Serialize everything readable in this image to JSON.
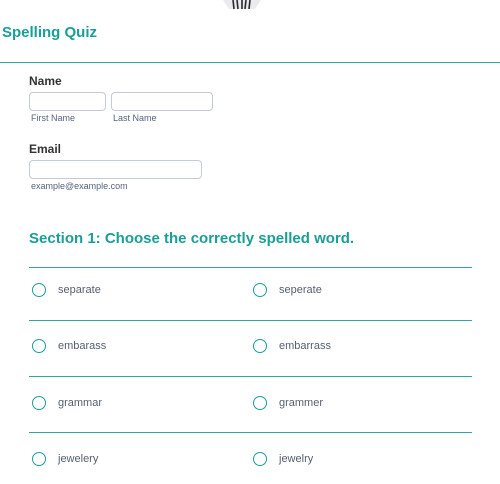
{
  "form": {
    "title": "Spelling Quiz"
  },
  "name_field": {
    "label": "Name",
    "first_name_value": "",
    "last_name_value": "",
    "first_sublabel": "First Name",
    "last_sublabel": "Last Name"
  },
  "email_field": {
    "label": "Email",
    "value": "",
    "sublabel": "example@example.com"
  },
  "section1": {
    "title": "Section 1: Choose the correctly spelled word.",
    "questions": [
      {
        "options": [
          "separate",
          "seperate"
        ]
      },
      {
        "options": [
          "embarass",
          "embarrass"
        ]
      },
      {
        "options": [
          "grammar",
          "grammer"
        ]
      },
      {
        "options": [
          "jewelery",
          "jewelry"
        ]
      }
    ]
  },
  "colors": {
    "accent": "#1a9f97",
    "input_border": "#c3cad8",
    "sublabel_text": "#57647e"
  }
}
